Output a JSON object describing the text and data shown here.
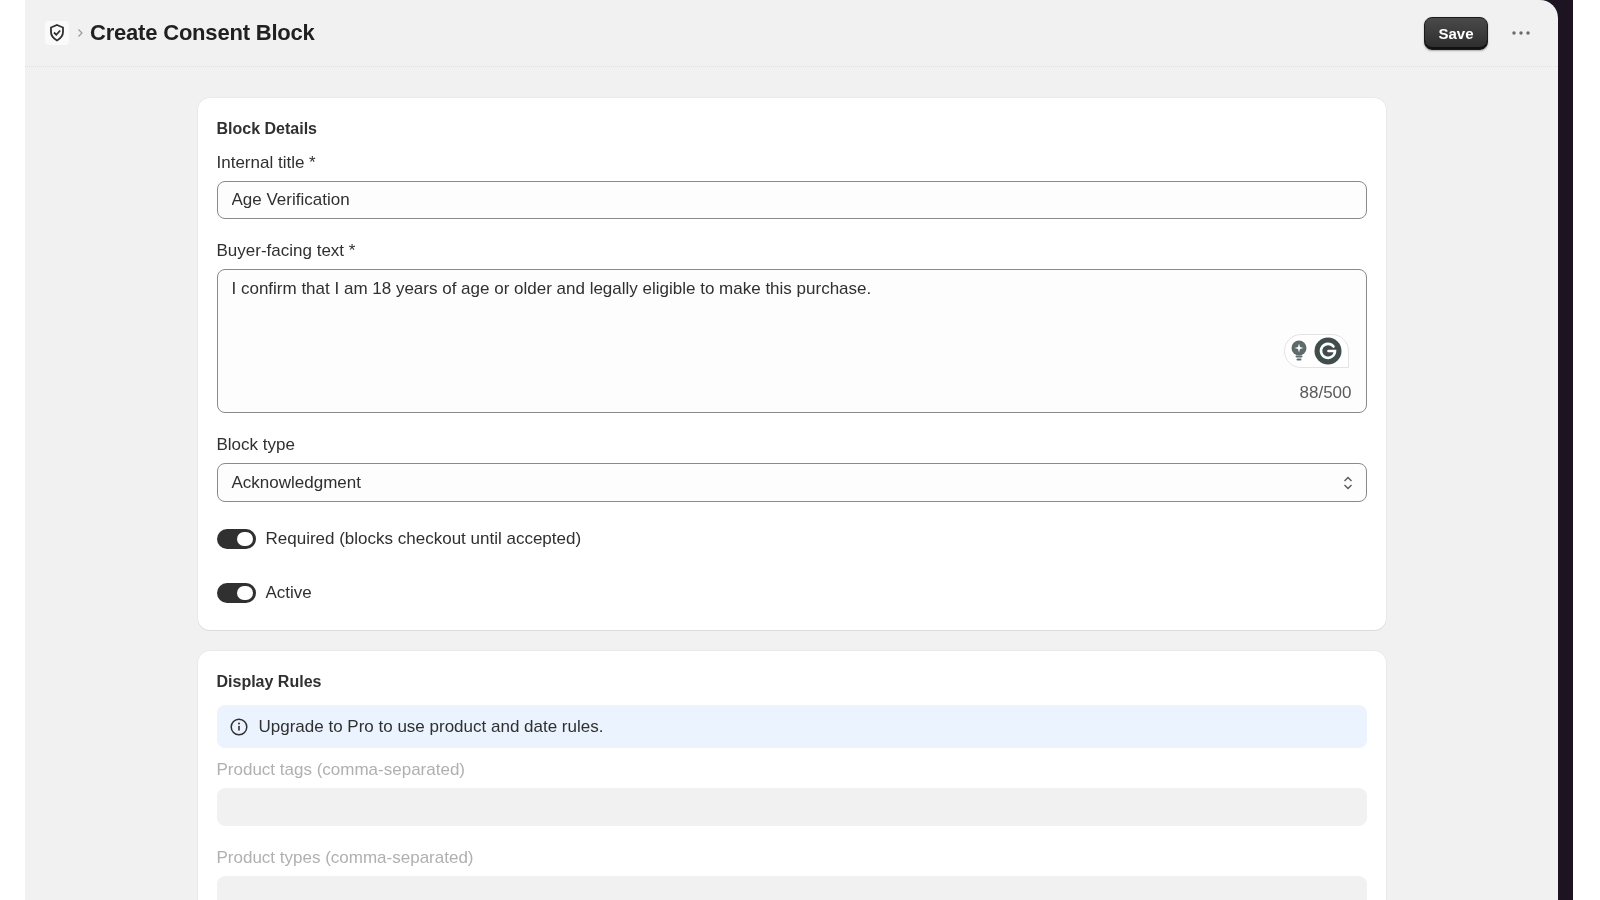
{
  "header": {
    "title": "Create Consent Block",
    "save_button": "Save"
  },
  "block_details": {
    "title": "Block Details",
    "internal_title": {
      "label": "Internal title *",
      "value": "Age Verification"
    },
    "buyer_facing_text": {
      "label": "Buyer-facing text *",
      "value": "I confirm that I am 18 years of age or older and legally eligible to make this purchase.",
      "counter": "88/500"
    },
    "block_type": {
      "label": "Block type",
      "value": "Acknowledgment"
    },
    "toggles": [
      {
        "label": "Required (blocks checkout until accepted)",
        "on": true
      },
      {
        "label": "Active",
        "on": true
      }
    ]
  },
  "display_rules": {
    "title": "Display Rules",
    "notice": "Upgrade to Pro to use product and date rules.",
    "fields": [
      {
        "label": "Product tags (comma-separated)",
        "disabled": true
      },
      {
        "label": "Product types (comma-separated)",
        "disabled": true
      }
    ]
  }
}
